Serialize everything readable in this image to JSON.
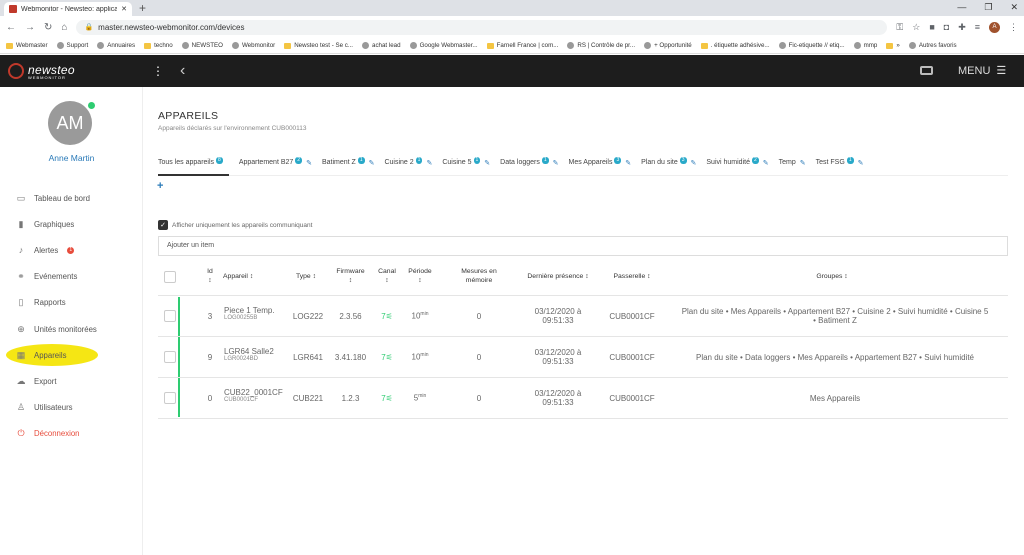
{
  "browser": {
    "tab_title": "Webmonitor - Newsteo: applicati",
    "url": "master.newsteo-webmonitor.com/devices",
    "bookmarks": [
      "Webmaster",
      "Support",
      "Annuaires",
      "techno",
      "NEWSTEO",
      "Webmonitor",
      "Newsteo test - Se c...",
      "achat lead",
      "Google Webmaster...",
      "Farnell France | com...",
      "RS | Contrôle de pr...",
      "+ Opportunité",
      ". étiquette adhésive...",
      "Fic-etiquette // etiq...",
      "mmp",
      "»",
      "Autres favoris"
    ],
    "profile_initial": "A"
  },
  "app": {
    "logo_text": "newsteo",
    "logo_sub": "WEBMONITOR",
    "menu_label": "MENU"
  },
  "user": {
    "initials": "AM",
    "name": "Anne Martin"
  },
  "sidebar": {
    "items": [
      {
        "label": "Tableau de bord",
        "icon": "monitor-icon"
      },
      {
        "label": "Graphiques",
        "icon": "bar-chart-icon"
      },
      {
        "label": "Alertes",
        "icon": "bell-icon",
        "badge": "1"
      },
      {
        "label": "Evénements",
        "icon": "link-icon"
      },
      {
        "label": "Rapports",
        "icon": "document-icon"
      },
      {
        "label": "Unités monitorées",
        "icon": "crosshair-icon"
      },
      {
        "label": "Appareils",
        "icon": "grid-icon",
        "active": true
      },
      {
        "label": "Export",
        "icon": "cloud-icon"
      },
      {
        "label": "Utilisateurs",
        "icon": "user-icon"
      },
      {
        "label": "Déconnexion",
        "icon": "power-icon"
      }
    ]
  },
  "page": {
    "title": "APPAREILS",
    "subtitle": "Appareils déclarés sur l'environnement CUB000113"
  },
  "tabs": [
    {
      "label": "Tous les appareils",
      "count": "8"
    },
    {
      "label": "Appartement B27",
      "count": "2"
    },
    {
      "label": "Batiment Z",
      "count": "1"
    },
    {
      "label": "Cuisine 2",
      "count": "1"
    },
    {
      "label": "Cuisine 5",
      "count": "1"
    },
    {
      "label": "Data loggers",
      "count": "1"
    },
    {
      "label": "Mes Appareils",
      "count": "3"
    },
    {
      "label": "Plan du site",
      "count": "3"
    },
    {
      "label": "Suivi humidité",
      "count": "2"
    },
    {
      "label": "Temp",
      "count": ""
    },
    {
      "label": "Test FSG",
      "count": "1"
    }
  ],
  "filter": {
    "label": "Afficher uniquement les appareils communiquant"
  },
  "search": {
    "placeholder": "Ajouter un item"
  },
  "table": {
    "headers": {
      "id": "Id",
      "appareil": "Appareil",
      "type": "Type",
      "firmware": "Firmware",
      "canal": "Canal",
      "periode": "Période",
      "mesures1": "Mesures en",
      "mesures2": "mémoire",
      "presence": "Dernière présence",
      "passerelle": "Passerelle",
      "groupes": "Groupes"
    },
    "rows": [
      {
        "id": "3",
        "name": "Piece 1 Temp.",
        "serial": "LOG00255B",
        "type": "LOG222",
        "firmware": "2.3.56",
        "canal": "7",
        "periode": "10",
        "periode_unit": "min",
        "mesures": "0",
        "presence1": "03/12/2020 à",
        "presence2": "09:51:33",
        "passerelle": "CUB0001CF",
        "groupes1": "Plan du site • Mes Appareils • Appartement B27 • Cuisine 2 • Suivi humidité • Cuisine 5",
        "groupes2": "• Batiment Z"
      },
      {
        "id": "9",
        "name": "LGR64 Salle2",
        "serial": "LGR0024BD",
        "type": "LGR641",
        "firmware": "3.41.180",
        "canal": "7",
        "periode": "10",
        "periode_unit": "min",
        "mesures": "0",
        "presence1": "03/12/2020 à",
        "presence2": "09:51:33",
        "passerelle": "CUB0001CF",
        "groupes1": "Plan du site • Data loggers • Mes Appareils • Appartement B27 • Suivi humidité",
        "groupes2": ""
      },
      {
        "id": "0",
        "name": "CUB22_0001CF",
        "serial": "CUB0001CF",
        "type": "CUB221",
        "firmware": "1.2.3",
        "canal": "7",
        "periode": "5",
        "periode_unit": "min",
        "mesures": "0",
        "presence1": "03/12/2020 à",
        "presence2": "09:51:33",
        "passerelle": "CUB0001CF",
        "groupes1": "Mes Appareils",
        "groupes2": ""
      }
    ]
  },
  "colors": {
    "accent": "#2a7ab8",
    "online": "#2ecc71",
    "danger": "#e74c3c",
    "highlight": "#f5e614",
    "header": "#1d1d1d"
  }
}
